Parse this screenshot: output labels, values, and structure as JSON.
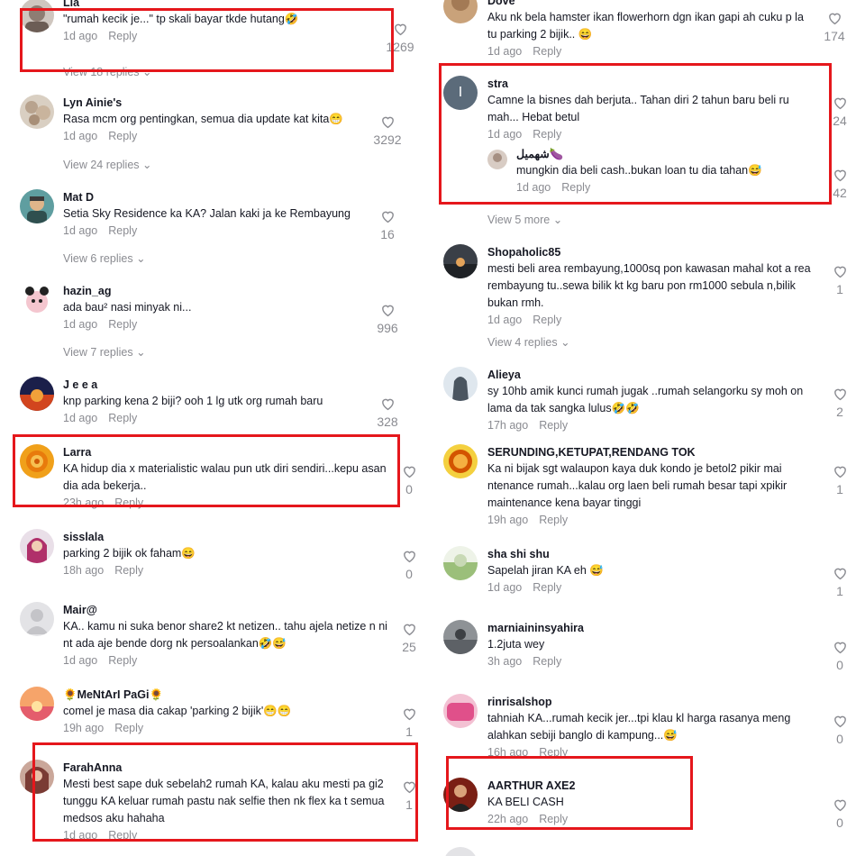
{
  "left": [
    {
      "user": "Lia",
      "text": "\"rumah kecik je...\" tp skali bayar tkde hutang🤣",
      "time": "1d ago",
      "reply": "Reply",
      "likes": "1269",
      "view": "View 18 replies"
    },
    {
      "user": "Lyn Ainie's",
      "text": "Rasa mcm org pentingkan, semua dia update kat kita😁",
      "time": "1d ago",
      "reply": "Reply",
      "likes": "3292",
      "view": "View 24 replies"
    },
    {
      "user": "Mat D",
      "text": "Setia Sky Residence ka KA? Jalan kaki ja ke Rembayung",
      "time": "1d ago",
      "reply": "Reply",
      "likes": "16",
      "view": "View 6 replies"
    },
    {
      "user": "hazin_ag",
      "text": "ada bau² nasi minyak ni...",
      "time": "1d ago",
      "reply": "Reply",
      "likes": "996",
      "view": "View 7 replies"
    },
    {
      "user": "J e e a",
      "text": "knp parking kena 2 biji? ooh 1 lg utk org rumah baru",
      "time": "1d ago",
      "reply": "Reply",
      "likes": "328"
    },
    {
      "user": "Larra",
      "text": "KA hidup dia x materialistic walau pun utk diri sendiri...kepu asan dia ada bekerja..",
      "time": "23h ago",
      "reply": "Reply",
      "likes": "0"
    },
    {
      "user": "sisslala",
      "text": "parking 2 bijik ok faham😄",
      "time": "18h ago",
      "reply": "Reply",
      "likes": "0"
    },
    {
      "user": "Mair@",
      "text": "KA.. kamu ni suka benor share2 kt netizen.. tahu ajela netize n ni nt ada aje bende dorg nk persoalankan🤣😅",
      "time": "1d ago",
      "reply": "Reply",
      "likes": "25"
    },
    {
      "user": "🌻MeNtArI PaGi🌻",
      "text": "comel je masa dia cakap 'parking 2 bijik'😁😁",
      "time": "19h ago",
      "reply": "Reply",
      "likes": "1"
    },
    {
      "user": "FarahAnna",
      "text": "Mesti best sape duk sebelah2 rumah KA, kalau aku mesti pa gi2 tunggu KA keluar rumah pastu nak selfie then nk flex ka t semua medsos aku hahaha",
      "time": "1d ago",
      "reply": "Reply",
      "likes": "1"
    }
  ],
  "right": [
    {
      "user": "Dove",
      "text": "Aku nk bela hamster ikan flowerhorn dgn ikan gapi ah cuku p la tu parking 2 bijik.. 😄",
      "time": "1d ago",
      "reply": "Reply",
      "likes": "174"
    },
    {
      "user": "stra",
      "text": "Camne la bisnes dah berjuta.. Tahan diri 2 tahun baru beli ru mah... Hebat betul",
      "time": "1d ago",
      "reply": "Reply",
      "likes": "24",
      "avatar_letter": "I",
      "sub": {
        "user": "شهميل🍆",
        "text": "mungkin dia beli cash..bukan loan tu dia tahan😅",
        "time": "1d ago",
        "reply": "Reply",
        "likes": "42"
      },
      "view": "View 5 more"
    },
    {
      "user": "Shopaholic85",
      "text": "mesti beli area rembayung,1000sq pon kawasan mahal kot a rea rembayung tu..sewa bilik kt kg baru pon rm1000 sebula n,bilik bukan rmh.",
      "time": "1d ago",
      "reply": "Reply",
      "likes": "1",
      "view": "View 4 replies"
    },
    {
      "user": "Alieya",
      "text": "sy 10hb amik kunci rumah jugak ..rumah selangorku sy moh on lama da tak sangka lulus🤣🤣",
      "time": "17h ago",
      "reply": "Reply",
      "likes": "2"
    },
    {
      "user": "SERUNDING,KETUPAT,RENDANG TOK",
      "text": "Ka ni bijak sgt walaupon kaya duk kondo je betol2 pikir mai ntenance rumah...kalau org laen beli rumah besar tapi xpikir maintenance kena bayar tinggi",
      "time": "19h ago",
      "reply": "Reply",
      "likes": "1"
    },
    {
      "user": "sha shi shu",
      "text": "Sapelah jiran KA eh 😅",
      "time": "1d ago",
      "reply": "Reply",
      "likes": "1"
    },
    {
      "user": "marniaininsyahira",
      "text": "1.2juta wey",
      "time": "3h ago",
      "reply": "Reply",
      "likes": "0"
    },
    {
      "user": "rinrisalshop",
      "text": "tahniah KA...rumah kecik jer...tpi klau kl harga rasanya meng alahkan sebiji banglo di kampung...😅",
      "time": "16h ago",
      "reply": "Reply",
      "likes": "0"
    },
    {
      "user": "AARTHUR AXE2",
      "text": "KA BELI CASH",
      "time": "22h ago",
      "reply": "Reply",
      "likes": "0"
    }
  ],
  "colors": {
    "highlight": "#e5171c",
    "muted": "#8a8b91",
    "text": "#161823"
  }
}
